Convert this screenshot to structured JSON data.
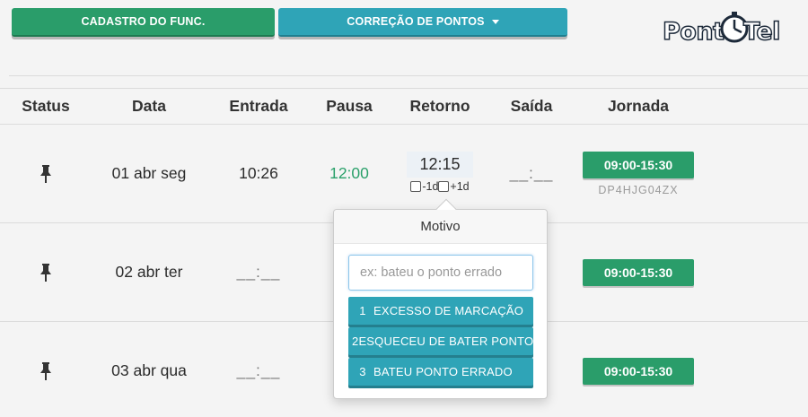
{
  "toolbar": {
    "cadastro_label": "CADASTRO DO FUNC.",
    "correcao_label": "CORREÇÃO DE PONTOS"
  },
  "logo": {
    "part1": "Ponto",
    "part2": "Tel"
  },
  "table": {
    "headers": [
      "Status",
      "Data",
      "Entrada",
      "Pausa",
      "Retorno",
      "Saída",
      "Jornada"
    ],
    "rows": [
      {
        "data": "01 abr seg",
        "entrada": "10:26",
        "pausa": "12:00",
        "retorno": "12:15",
        "retorno_minus": "-1d",
        "retorno_plus": "+1d",
        "saida": "__:__",
        "jornada": "09:00-15:30",
        "code": "DP4HJG04ZX"
      },
      {
        "data": "02 abr ter",
        "entrada": "__:__",
        "jornada": "09:00-15:30"
      },
      {
        "data": "03 abr qua",
        "entrada": "__:__",
        "jornada": "09:00-15:30"
      }
    ]
  },
  "popover": {
    "title": "Motivo",
    "placeholder": "ex: bateu o ponto errado",
    "options": [
      {
        "num": "1",
        "label": "EXCESSO DE MARCAÇÃO"
      },
      {
        "num": "2",
        "label": "ESQUECEU DE BATER PONTO"
      },
      {
        "num": "3",
        "label": "BATEU PONTO ERRADO"
      }
    ]
  },
  "colors": {
    "green": "#2a9d6a",
    "teal": "#2fa4b7"
  }
}
